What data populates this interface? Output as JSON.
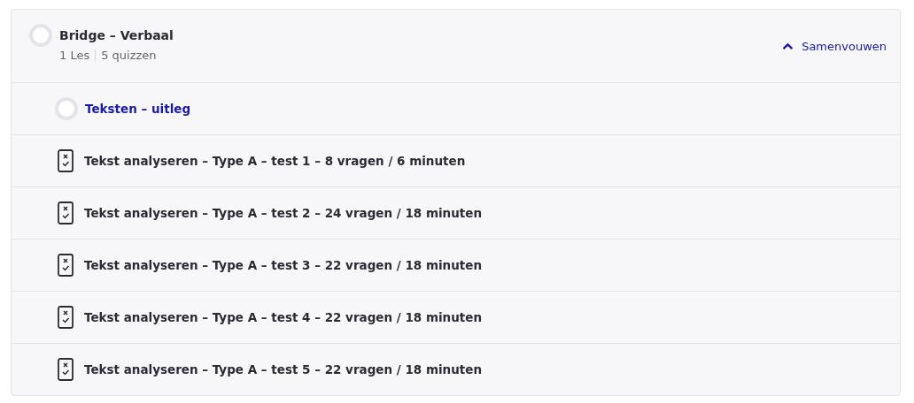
{
  "section": {
    "title": "Bridge – Verbaal",
    "completed": false,
    "meta": [
      "1 Les",
      "5 quizzen"
    ],
    "expanded": true,
    "toggle_label": "Samenvouwen",
    "items": [
      {
        "kind": "lesson",
        "title": "Teksten – uitleg",
        "completed": false
      },
      {
        "kind": "quiz",
        "title": "Tekst analyseren – Type A – test 1 – 8 vragen / 6 minuten"
      },
      {
        "kind": "quiz",
        "title": "Tekst analyseren – Type A – test 2 – 24 vragen / 18 minuten"
      },
      {
        "kind": "quiz",
        "title": "Tekst analyseren – Type A – test 3 – 22 vragen / 18 minuten"
      },
      {
        "kind": "quiz",
        "title": "Tekst analyseren – Type A – test 4 – 22 vragen / 18 minuten"
      },
      {
        "kind": "quiz",
        "title": "Tekst analyseren – Type A – test 5 – 22 vragen / 18 minuten"
      }
    ]
  }
}
